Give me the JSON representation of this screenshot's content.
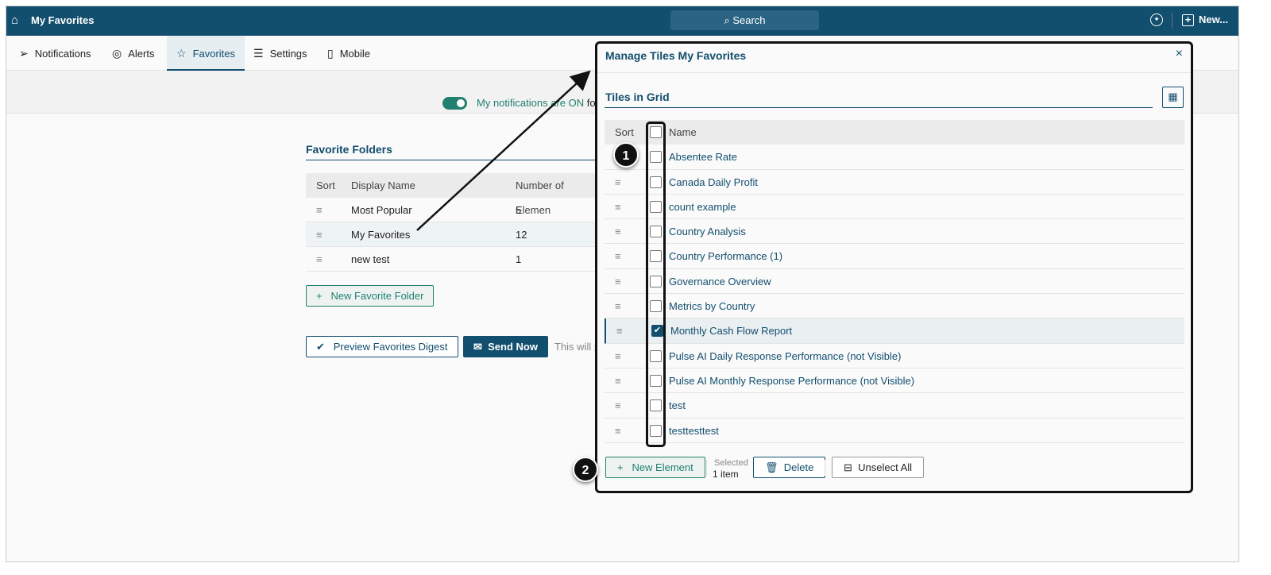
{
  "header": {
    "title": "My Favorites",
    "search": "Search",
    "new": "New..."
  },
  "tabs": [
    {
      "label": "Notifications",
      "icon": "send-icon"
    },
    {
      "label": "Alerts",
      "icon": "globe-icon"
    },
    {
      "label": "Favorites",
      "icon": "star-icon"
    },
    {
      "label": "Settings",
      "icon": "sliders-icon"
    },
    {
      "label": "Mobile",
      "icon": "phone-icon"
    }
  ],
  "notifications": {
    "text": "My notifications are ON",
    "suffix": "fo"
  },
  "folders": {
    "title": "Favorite Folders",
    "headers": [
      "Sort",
      "Display Name",
      "Number of Elemen"
    ],
    "rows": [
      {
        "name": "Most Popular",
        "count": "5"
      },
      {
        "name": "My Favorites",
        "count": "12"
      },
      {
        "name": "new test",
        "count": "1"
      }
    ],
    "new_button": "New Favorite Folder",
    "preview_button": "Preview Favorites Digest",
    "send_button": "Send Now",
    "hint": "This will s"
  },
  "modal": {
    "title": "Manage Tiles My Favorites",
    "section": "Tiles in Grid",
    "headers": [
      "Sort",
      "Name"
    ],
    "tiles": [
      {
        "name": "Absentee Rate",
        "checked": false
      },
      {
        "name": "Canada Daily Profit",
        "checked": false
      },
      {
        "name": "count example",
        "checked": false
      },
      {
        "name": "Country Analysis",
        "checked": false
      },
      {
        "name": "Country Performance (1)",
        "checked": false
      },
      {
        "name": "Governance Overview",
        "checked": false
      },
      {
        "name": "Metrics by Country",
        "checked": false
      },
      {
        "name": "Monthly Cash Flow Report",
        "checked": true
      },
      {
        "name": "Pulse AI Daily Response Performance (not Visible)",
        "checked": false
      },
      {
        "name": "Pulse AI Monthly Response Performance (not Visible)",
        "checked": false
      },
      {
        "name": "test",
        "checked": false
      },
      {
        "name": "testtesttest",
        "checked": false
      }
    ],
    "new_element": "New Element",
    "selected_label": "Selected",
    "selected_count": "1 item",
    "delete": "Delete",
    "unselect_all": "Unselect All"
  },
  "annotations": [
    "1",
    "2"
  ],
  "colors": {
    "brand": "#124e6e",
    "accent": "#22806f"
  }
}
